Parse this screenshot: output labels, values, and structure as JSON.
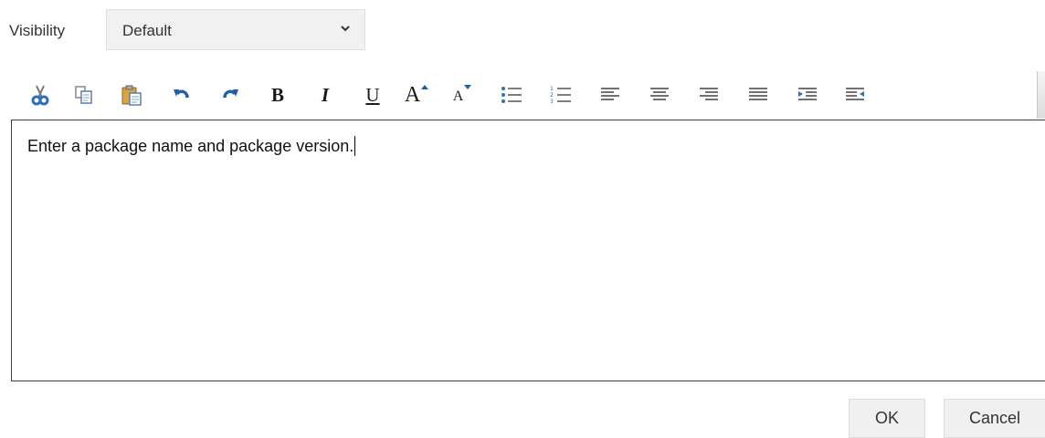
{
  "visibility": {
    "label": "Visibility",
    "selected": "Default"
  },
  "toolbar": {
    "buttons": [
      {
        "name": "cut",
        "icon": "scissors-icon"
      },
      {
        "name": "copy",
        "icon": "copy-icon"
      },
      {
        "name": "paste",
        "icon": "paste-icon"
      },
      {
        "name": "undo",
        "icon": "undo-icon"
      },
      {
        "name": "redo",
        "icon": "redo-icon"
      },
      {
        "name": "bold",
        "text": "B"
      },
      {
        "name": "italic",
        "text": "I"
      },
      {
        "name": "underline",
        "text": "U"
      },
      {
        "name": "grow-font",
        "text": "A"
      },
      {
        "name": "shrink-font",
        "text": "A"
      },
      {
        "name": "bullet-list",
        "icon": "bullet-list-icon"
      },
      {
        "name": "numbered-list",
        "icon": "numbered-list-icon"
      },
      {
        "name": "align-left",
        "icon": "align-left-icon"
      },
      {
        "name": "align-center",
        "icon": "align-center-icon"
      },
      {
        "name": "align-right",
        "icon": "align-right-icon"
      },
      {
        "name": "justify",
        "icon": "justify-icon"
      },
      {
        "name": "increase-indent",
        "icon": "indent-icon"
      },
      {
        "name": "decrease-indent",
        "icon": "outdent-icon"
      }
    ],
    "accent": "#2a6fb8",
    "icon_red": "#c0392b"
  },
  "editor": {
    "text": "Enter a package name and package version."
  },
  "actions": {
    "ok_label": "OK",
    "cancel_label": "Cancel"
  }
}
